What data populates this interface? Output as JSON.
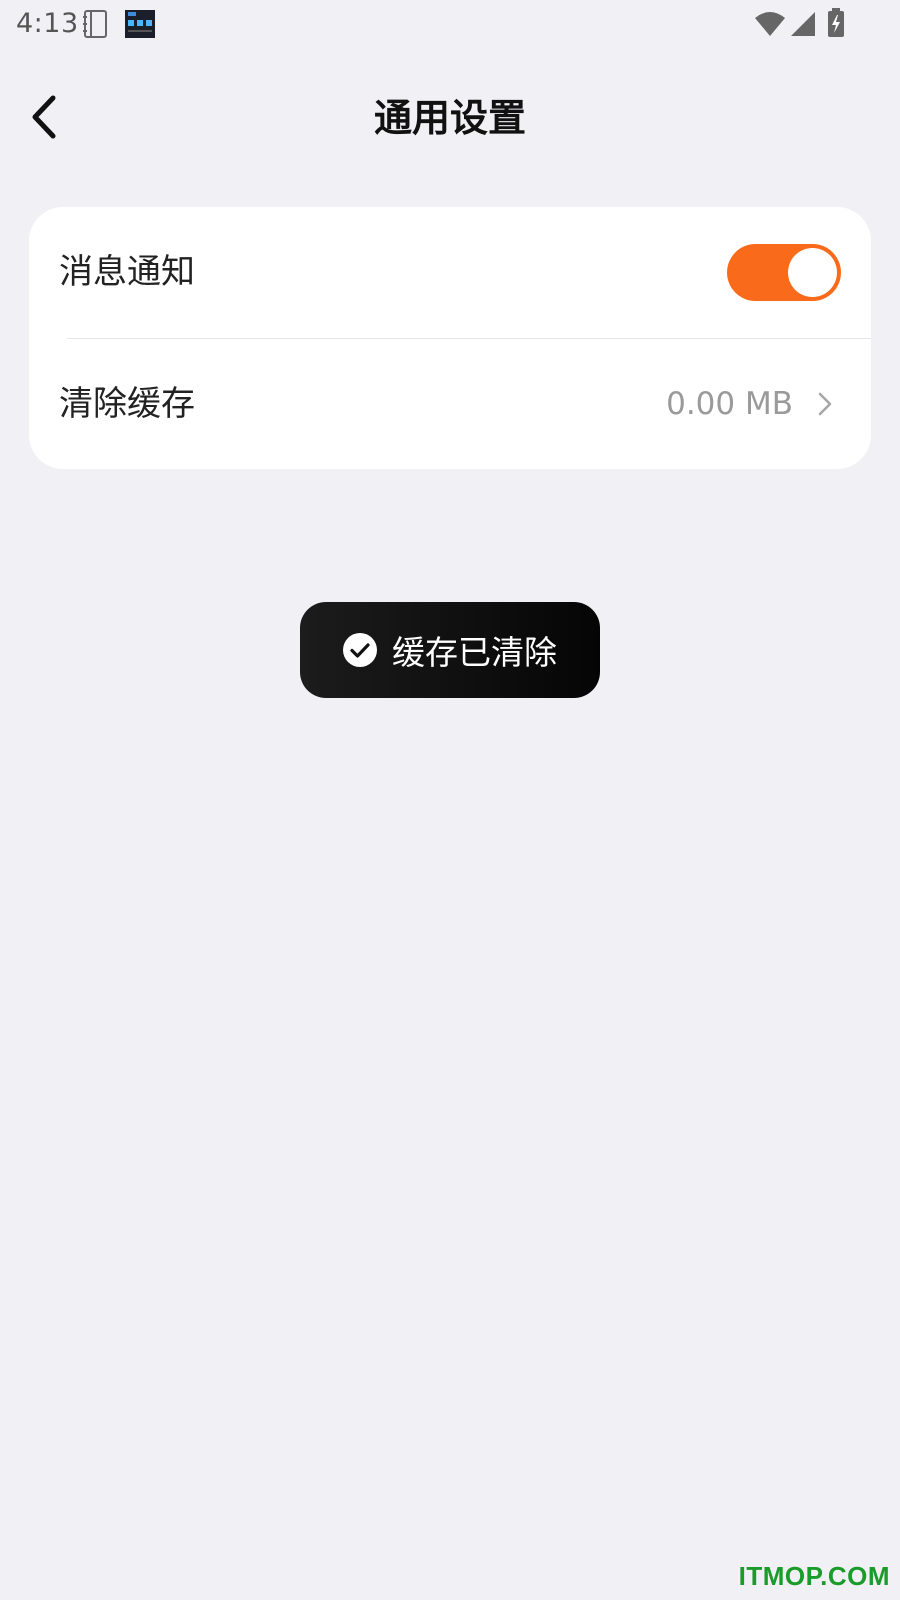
{
  "status_bar": {
    "time": "4:13",
    "icons": [
      "notebook-icon",
      "clock-app-icon",
      "wifi-icon",
      "signal-icon",
      "battery-charging-icon"
    ]
  },
  "header": {
    "title": "通用设置",
    "back_icon": "chevron-left-icon"
  },
  "settings": {
    "notification": {
      "label": "消息通知",
      "enabled": true
    },
    "clear_cache": {
      "label": "清除缓存",
      "value": "0.00 MB",
      "icon": "chevron-right-icon"
    }
  },
  "toast": {
    "icon": "check-circle-icon",
    "text": "缓存已清除"
  },
  "watermark": "ITMOP.COM",
  "colors": {
    "accent": "#f96a1a",
    "background": "#f1f0f5",
    "card": "#ffffff",
    "toast_bg": "#111111",
    "watermark": "#1a9b2a"
  }
}
